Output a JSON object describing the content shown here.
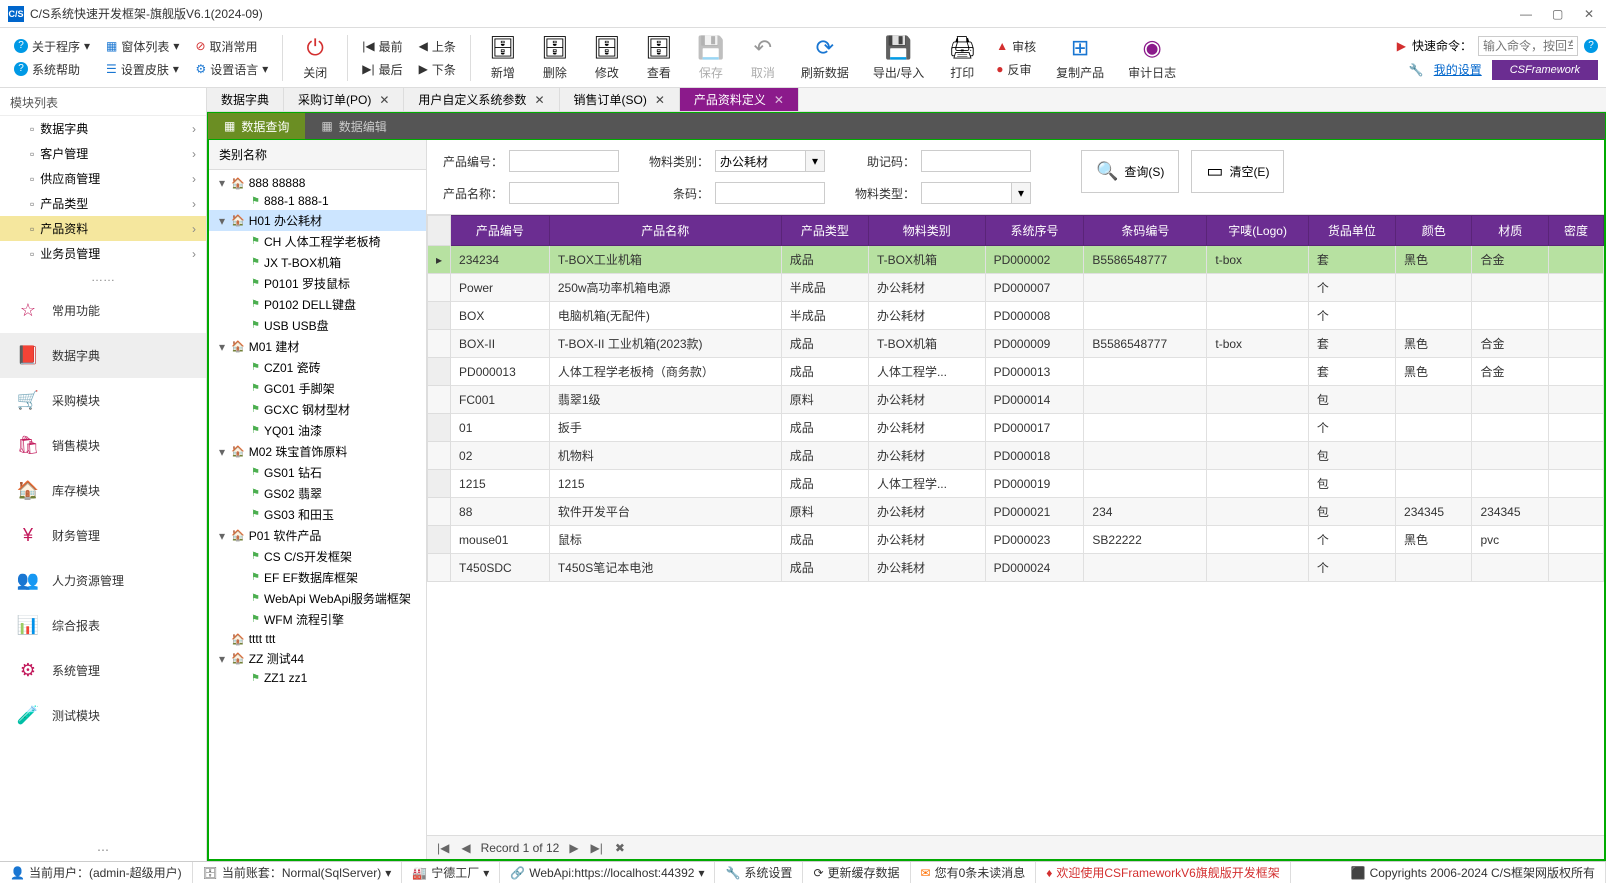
{
  "window": {
    "title": "C/S系统快速开发框架-旗舰版V6.1(2024-09)"
  },
  "toolbar": {
    "about": "关于程序",
    "winlist": "窗体列表",
    "cancel_common": "取消常用",
    "syshelp": "系统帮助",
    "setskin": "设置皮肤",
    "setlang": "设置语言",
    "close": "关闭",
    "first": "最前",
    "prev": "上条",
    "last": "最后",
    "next": "下条",
    "add": "新增",
    "del": "删除",
    "edit": "修改",
    "view": "查看",
    "save": "保存",
    "cancel": "取消",
    "refresh": "刷新数据",
    "export": "导出/导入",
    "print": "打印",
    "approve": "审核",
    "unapprove": "反审",
    "copyprod": "复制产品",
    "auditlog": "审计日志",
    "quick_cmd_label": "快速命令：",
    "quick_cmd_placeholder": "输入命令，按回车",
    "my_settings": "我的设置",
    "brand": "CSFramework"
  },
  "sidebar": {
    "title": "模块列表",
    "top": [
      {
        "label": "数据字典"
      },
      {
        "label": "客户管理"
      },
      {
        "label": "供应商管理"
      },
      {
        "label": "产品类型"
      },
      {
        "label": "产品资料",
        "active": true
      },
      {
        "label": "业务员管理"
      }
    ],
    "dots": "……",
    "modules": [
      {
        "label": "常用功能"
      },
      {
        "label": "数据字典",
        "big": true
      },
      {
        "label": "采购模块"
      },
      {
        "label": "销售模块"
      },
      {
        "label": "库存模块"
      },
      {
        "label": "财务管理"
      },
      {
        "label": "人力资源管理"
      },
      {
        "label": "综合报表"
      },
      {
        "label": "系统管理"
      },
      {
        "label": "测试模块"
      }
    ]
  },
  "tabs": [
    {
      "label": "数据字典"
    },
    {
      "label": "采购订单(PO)",
      "closable": true
    },
    {
      "label": "用户自定义系统参数",
      "closable": true
    },
    {
      "label": "销售订单(SO)",
      "closable": true
    },
    {
      "label": "产品资料定义",
      "closable": true,
      "active": true
    }
  ],
  "subtabs": [
    {
      "label": "数据查询",
      "active": true
    },
    {
      "label": "数据编辑"
    }
  ],
  "tree": {
    "header": "类别名称",
    "nodes": [
      {
        "level": 0,
        "exp": "▾",
        "ico": "home",
        "label": "888 88888"
      },
      {
        "level": 1,
        "ico": "leaf",
        "label": "888-1 888-1"
      },
      {
        "level": 0,
        "exp": "▾",
        "ico": "home",
        "label": "H01 办公耗材",
        "sel": true
      },
      {
        "level": 1,
        "ico": "leaf",
        "label": "CH 人体工程学老板椅"
      },
      {
        "level": 1,
        "ico": "leaf",
        "label": "JX T-BOX机箱"
      },
      {
        "level": 1,
        "ico": "leaf",
        "label": "P0101 罗技鼠标"
      },
      {
        "level": 1,
        "ico": "leaf",
        "label": "P0102 DELL键盘"
      },
      {
        "level": 1,
        "ico": "leaf",
        "label": "USB USB盘"
      },
      {
        "level": 0,
        "exp": "▾",
        "ico": "home",
        "label": "M01 建材"
      },
      {
        "level": 1,
        "ico": "leaf",
        "label": "CZ01 瓷砖"
      },
      {
        "level": 1,
        "ico": "leaf",
        "label": "GC01 手脚架"
      },
      {
        "level": 1,
        "ico": "leaf",
        "label": "GCXC 钢材型材"
      },
      {
        "level": 1,
        "ico": "leaf",
        "label": "YQ01 油漆"
      },
      {
        "level": 0,
        "exp": "▾",
        "ico": "home",
        "label": "M02 珠宝首饰原料"
      },
      {
        "level": 1,
        "ico": "leaf",
        "label": "GS01 钻石"
      },
      {
        "level": 1,
        "ico": "leaf",
        "label": "GS02 翡翠"
      },
      {
        "level": 1,
        "ico": "leaf",
        "label": "GS03 和田玉"
      },
      {
        "level": 0,
        "exp": "▾",
        "ico": "home",
        "label": "P01 软件产品"
      },
      {
        "level": 1,
        "ico": "leaf",
        "label": "CS C/S开发框架"
      },
      {
        "level": 1,
        "ico": "leaf",
        "label": "EF EF数据库框架"
      },
      {
        "level": 1,
        "ico": "leaf",
        "label": "WebApi WebApi服务端框架"
      },
      {
        "level": 1,
        "ico": "leaf",
        "label": "WFM 流程引擎"
      },
      {
        "level": 0,
        "ico": "home",
        "label": "tttt ttt"
      },
      {
        "level": 0,
        "exp": "▾",
        "ico": "home",
        "label": "ZZ 测试44"
      },
      {
        "level": 1,
        "ico": "leaf",
        "label": "ZZ1 zz1"
      }
    ]
  },
  "filter": {
    "prod_no_label": "产品编号：",
    "prod_name_label": "产品名称：",
    "mat_cat_label": "物料类别：",
    "mat_cat_value": "办公耗材",
    "barcode_label": "条码：",
    "mnemonic_label": "助记码：",
    "mat_type_label": "物料类型：",
    "query_btn": "查询(S)",
    "clear_btn": "清空(E)"
  },
  "grid": {
    "columns": [
      "产品编号",
      "产品名称",
      "产品类型",
      "物料类别",
      "系统序号",
      "条码编号",
      "字唛(Logo)",
      "货品单位",
      "颜色",
      "材质",
      "密度"
    ],
    "rows": [
      {
        "sel": true,
        "c": [
          "234234",
          "T-BOX工业机箱",
          "成品",
          "T-BOX机箱",
          "PD000002",
          "B5586548777",
          "t-box",
          "套",
          "黑色",
          "合金",
          ""
        ]
      },
      {
        "c": [
          "Power",
          "250w高功率机箱电源",
          "半成品",
          "办公耗材",
          "PD000007",
          "",
          "",
          "个",
          "",
          "",
          ""
        ]
      },
      {
        "c": [
          "BOX",
          "电脑机箱(无配件)",
          "半成品",
          "办公耗材",
          "PD000008",
          "",
          "",
          "个",
          "",
          "",
          ""
        ]
      },
      {
        "c": [
          "BOX-II",
          "T-BOX-II 工业机箱(2023款)",
          "成品",
          "T-BOX机箱",
          "PD000009",
          "B5586548777",
          "t-box",
          "套",
          "黑色",
          "合金",
          ""
        ]
      },
      {
        "c": [
          "PD000013",
          "人体工程学老板椅（商务款）",
          "成品",
          "人体工程学...",
          "PD000013",
          "",
          "",
          "套",
          "黑色",
          "合金",
          ""
        ]
      },
      {
        "c": [
          "FC001",
          "翡翠1级",
          "原料",
          "办公耗材",
          "PD000014",
          "",
          "",
          "包",
          "",
          "",
          ""
        ]
      },
      {
        "c": [
          "01",
          "扳手",
          "成品",
          "办公耗材",
          "PD000017",
          "",
          "",
          "个",
          "",
          "",
          ""
        ]
      },
      {
        "c": [
          "02",
          "机物料",
          "成品",
          "办公耗材",
          "PD000018",
          "",
          "",
          "包",
          "",
          "",
          ""
        ]
      },
      {
        "c": [
          "1215",
          "1215",
          "成品",
          "人体工程学...",
          "PD000019",
          "",
          "",
          "包",
          "",
          "",
          ""
        ]
      },
      {
        "c": [
          "88",
          "软件开发平台",
          "原料",
          "办公耗材",
          "PD000021",
          "234",
          "",
          "包",
          "234345",
          "234345",
          ""
        ]
      },
      {
        "c": [
          "mouse01",
          "鼠标",
          "成品",
          "办公耗材",
          "PD000023",
          "SB22222",
          "",
          "个",
          "黑色",
          "pvc",
          ""
        ]
      },
      {
        "c": [
          "T450SDC",
          "T450S笔记本电池",
          "成品",
          "办公耗材",
          "PD000024",
          "",
          "",
          "个",
          "",
          "",
          ""
        ]
      }
    ],
    "paginator": "Record 1 of 12"
  },
  "statusbar": {
    "user": "当前用户：(admin-超级用户)",
    "account": "当前账套：Normal(SqlServer)",
    "factory": "宁德工厂",
    "webapi": "WebApi:https://localhost:44392",
    "syscfg": "系统设置",
    "refcache": "更新缓存数据",
    "unread": "您有0条未读消息",
    "welcome": "欢迎使用CSFrameworkV6旗舰版开发框架",
    "copyright": "Copyrights 2006-2024 C/S框架网版权所有"
  }
}
